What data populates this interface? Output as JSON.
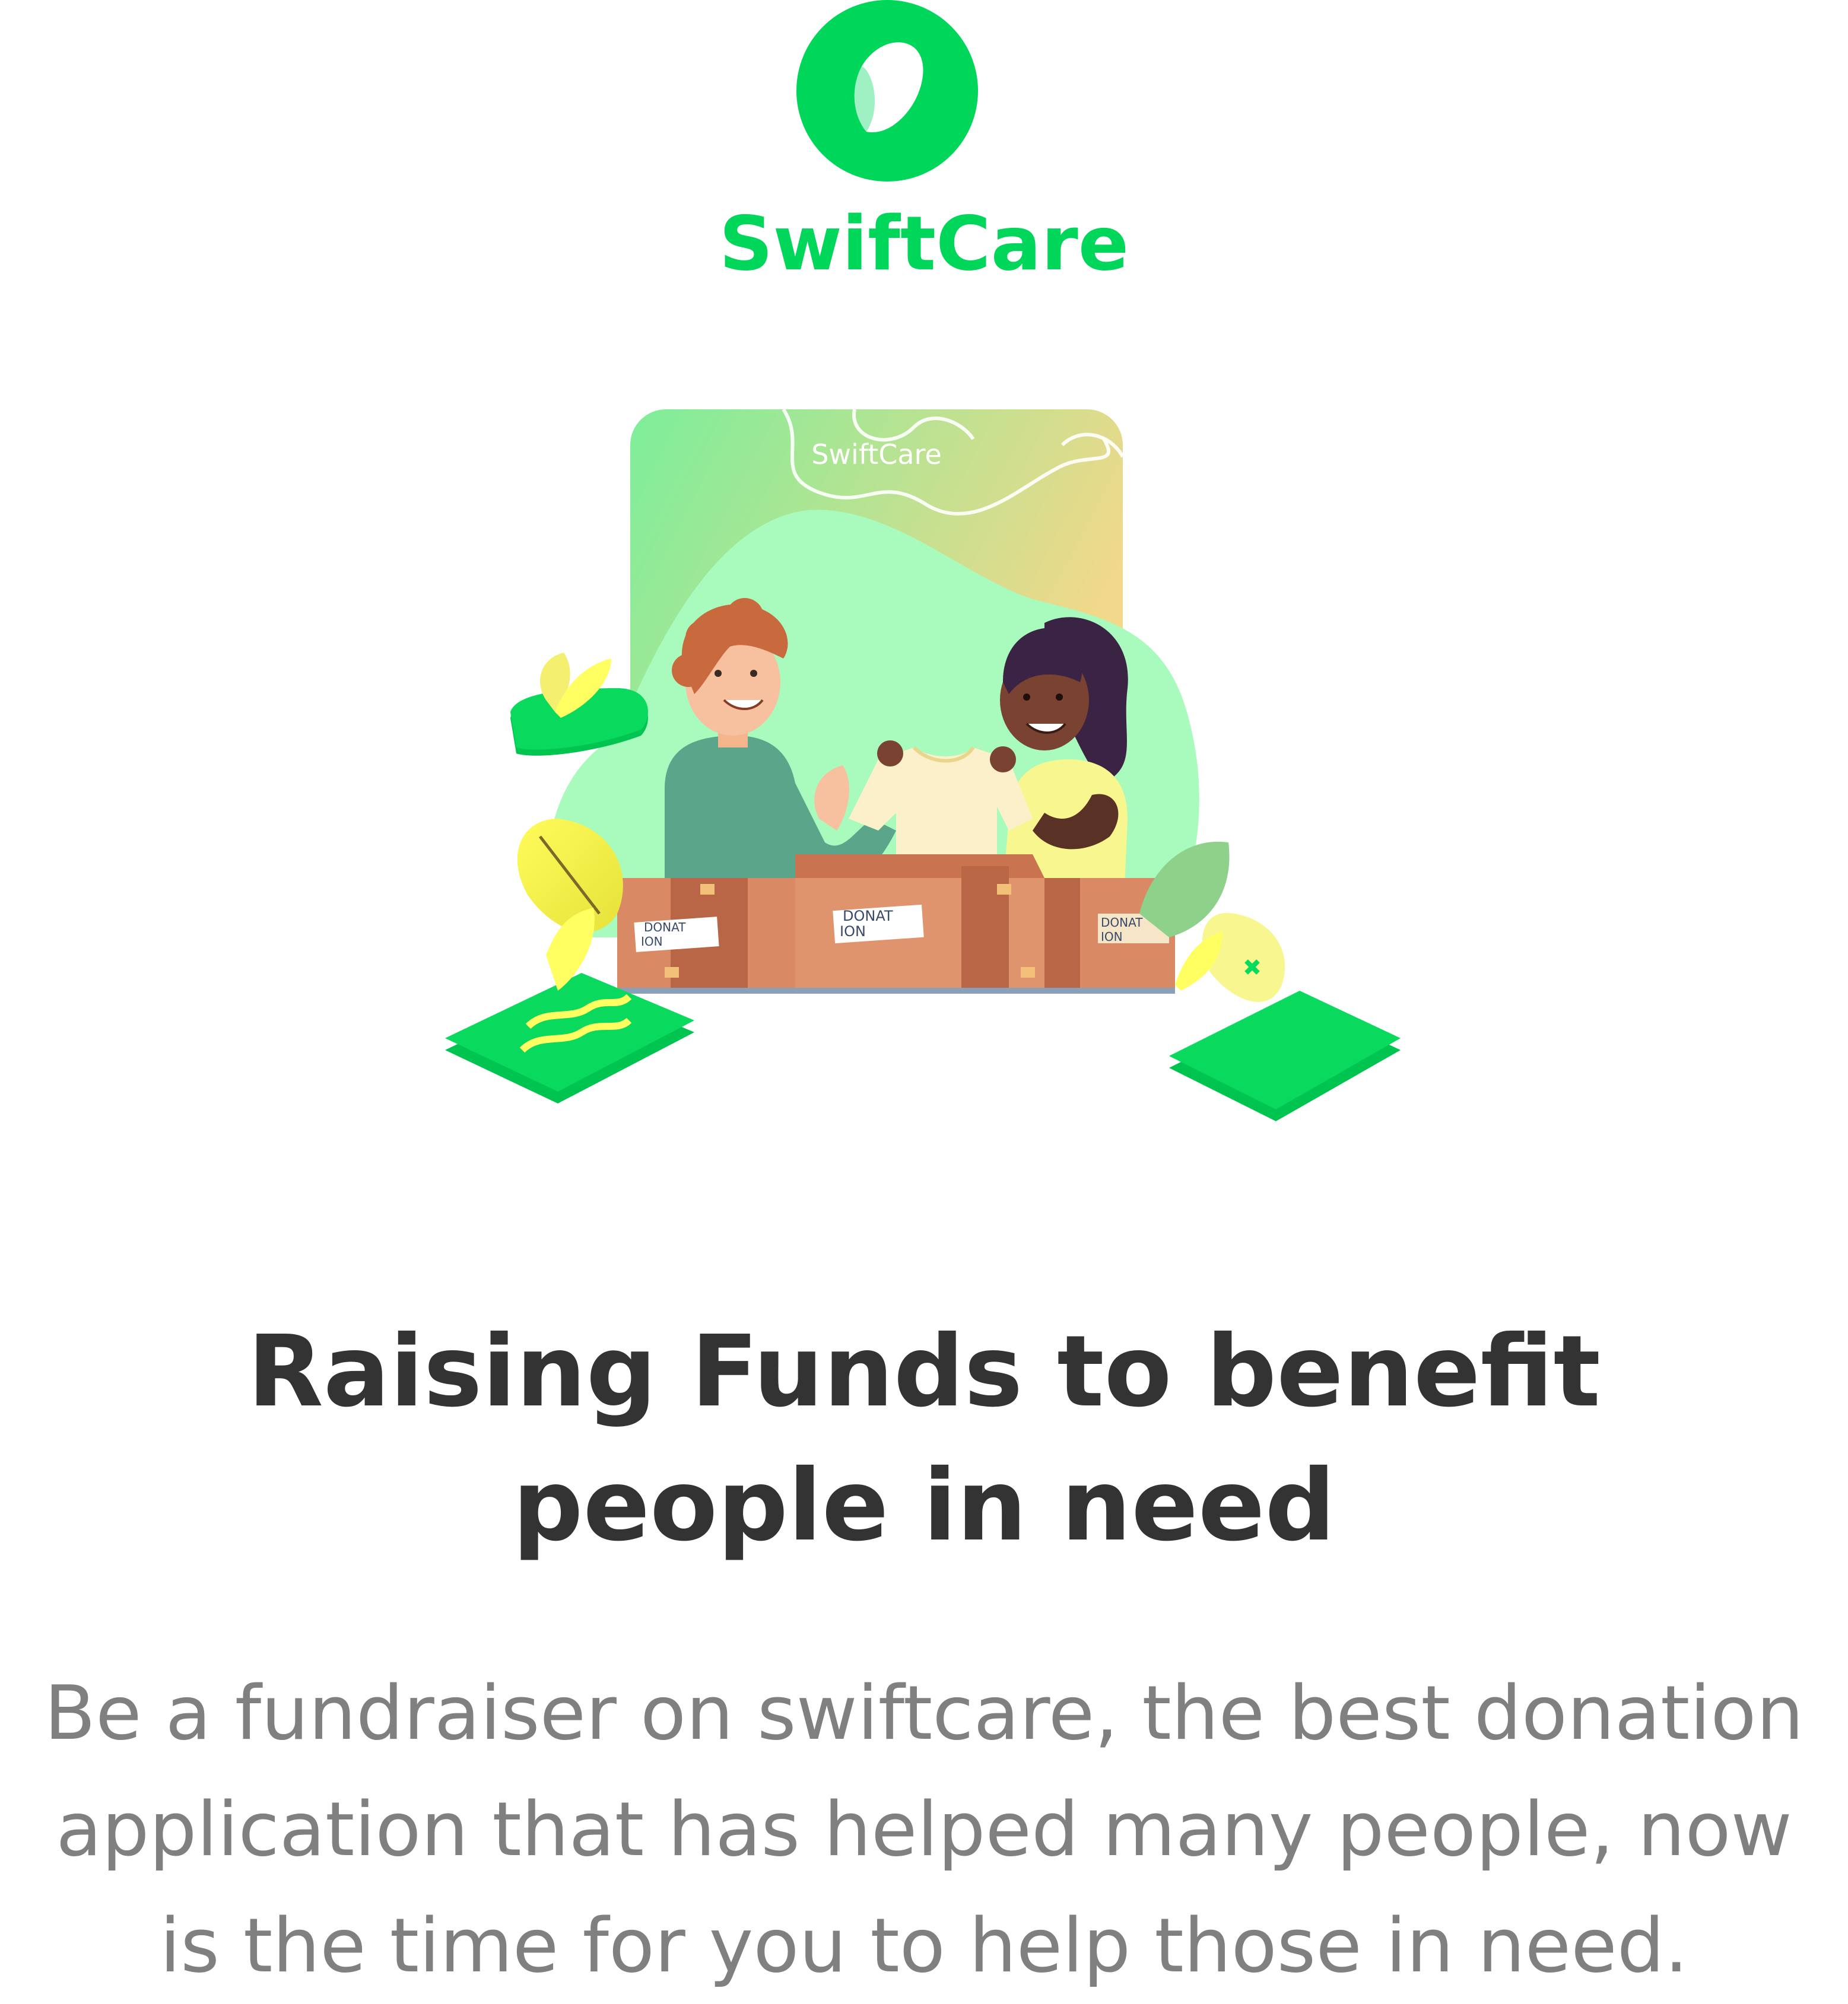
{
  "brand": {
    "name": "SwiftCare",
    "color": "#00d659",
    "logo_icon": "heart-leaf-icon"
  },
  "illustration": {
    "card_label": "SwiftCare",
    "box_labels": [
      [
        "DONAT",
        "ION"
      ],
      [
        "DONAT",
        "ION"
      ],
      [
        "DONAT",
        "ION"
      ]
    ],
    "icons": [
      "person-man-icon",
      "person-woman-icon",
      "shirt-icon",
      "donation-box-icon",
      "leaf-icon",
      "plant-icon"
    ]
  },
  "headline": {
    "line1": "Raising Funds to benefit",
    "line2": "people in need"
  },
  "description": {
    "line1": "Be a fundraiser on swiftcare, the best donation",
    "line2": "application that has helped many people, now",
    "line3": "is the time for you to help those in need."
  }
}
